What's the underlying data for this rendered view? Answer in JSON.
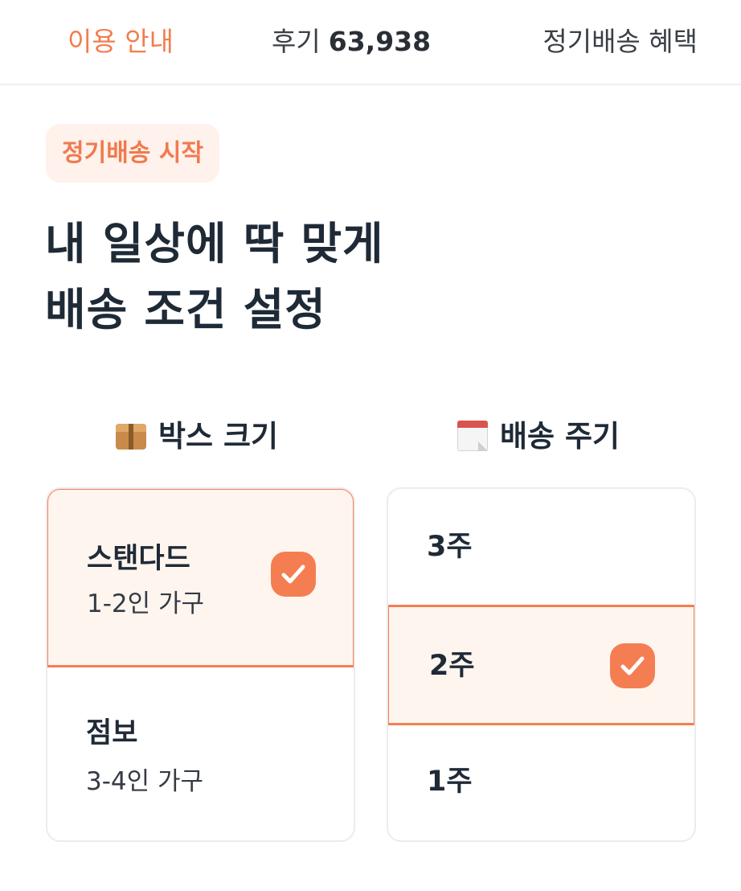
{
  "tabs": {
    "guide": "이용 안내",
    "reviews_label": "후기",
    "reviews_count": "63,938",
    "benefits": "정기배송 혜택",
    "active": "guide"
  },
  "badge": "정기배송 시작",
  "headline": {
    "line1": "내 일상에 딱 맞게",
    "line2": "배송 조건 설정"
  },
  "box_size": {
    "title": "박스 크기",
    "icon": "package-emoji",
    "options": [
      {
        "name": "스탠다드",
        "sub": "1-2인 가구",
        "selected": true
      },
      {
        "name": "점보",
        "sub": "3-4인 가구",
        "selected": false
      }
    ]
  },
  "delivery_cycle": {
    "title": "배송 주기",
    "icon": "calendar-emoji",
    "options": [
      {
        "name": "3주",
        "selected": false
      },
      {
        "name": "2주",
        "selected": true
      },
      {
        "name": "1주",
        "selected": false
      }
    ]
  },
  "colors": {
    "accent": "#f47e52",
    "badge_bg": "#fff1ec",
    "selected_bg": "#fff5ef",
    "text_dark": "#1f2a37"
  }
}
